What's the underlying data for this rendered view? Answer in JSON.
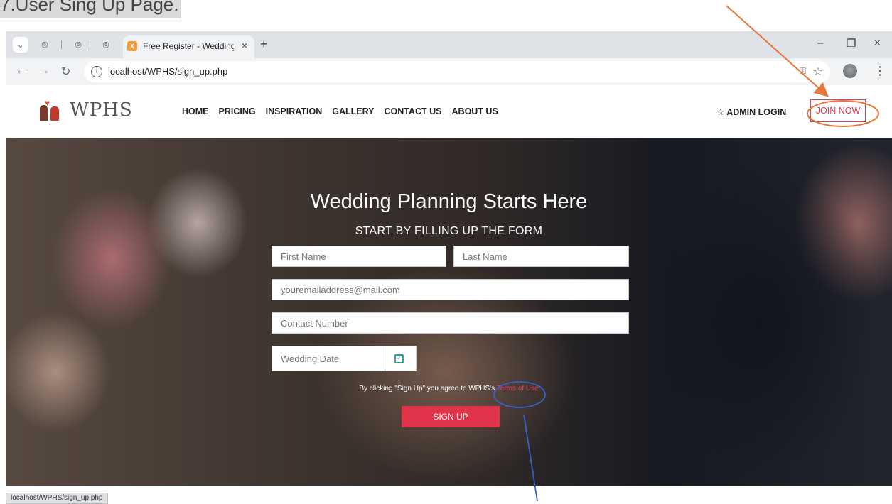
{
  "caption": "7.User Sing Up Page.",
  "browser": {
    "tab_title": "Free Register - Wedding Planne",
    "tab_close": "×",
    "new_tab": "+",
    "window_controls": {
      "minimize": "–",
      "restore": "❐",
      "close": "×"
    },
    "url": "localhost/WPHS/sign_up.php",
    "icons": [
      "back-icon",
      "forward-icon",
      "reload-icon",
      "info-icon",
      "key-icon",
      "star-icon",
      "avatar",
      "menu-icon"
    ]
  },
  "site": {
    "logo_text": "WPHS",
    "nav": [
      "HOME",
      "PRICING",
      "INSPIRATION",
      "GALLERY",
      "CONTACT US",
      "ABOUT US"
    ],
    "admin_login": "ADMIN LOGIN",
    "join_now": "JOIN NOW"
  },
  "hero": {
    "heading": "Wedding Planning Starts Here",
    "subheading": "START BY FILLING UP THE FORM",
    "placeholders": {
      "first_name": "First Name",
      "last_name": "Last Name",
      "email": "youremailaddress@mail.com",
      "contact": "Contact Number",
      "wedding_date": "Wedding Date"
    },
    "terms_prefix": "By clicking \"Sign Up\" you agree to WPHS's ",
    "terms_link": "Terms of Use",
    "signup_button": "SIGN UP"
  },
  "status_url": "localhost/WPHS/sign_up.php",
  "colors": {
    "accent": "#e0344c",
    "annotation_arrow_1": "#e6773a",
    "annotation_arrow_2": "#3b5fc8"
  }
}
